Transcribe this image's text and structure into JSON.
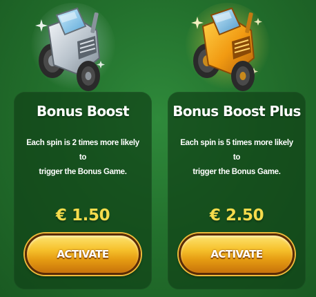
{
  "offers": [
    {
      "title": "Bonus Boost",
      "description_line1": "Each spin is 2 times more likely to",
      "description_line2": "trigger the Bonus Game.",
      "price": "€ 1.50",
      "button_label": "ACTIVATE",
      "icon": "silver-tractor-icon"
    },
    {
      "title": "Bonus Boost Plus",
      "description_line1": "Each spin is 5 times more likely to",
      "description_line2": "trigger the Bonus Game.",
      "price": "€ 2.50",
      "button_label": "ACTIVATE",
      "icon": "gold-tractor-icon"
    }
  ],
  "colors": {
    "background": "#23712d",
    "card": "#10421a",
    "price": "#f5dc4c",
    "button": "#f6c12c"
  }
}
